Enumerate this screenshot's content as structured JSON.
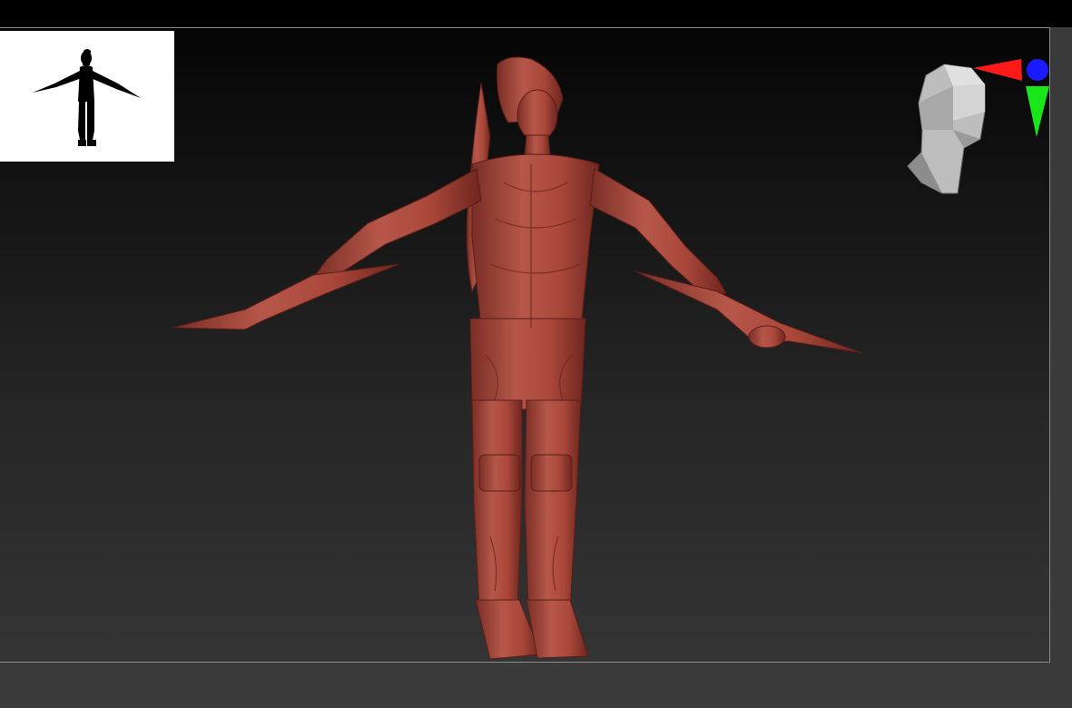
{
  "app": {
    "viewport_bg_top": "#050505",
    "viewport_bg_bottom": "#343434",
    "frame_border": "#8a8a8a"
  },
  "thumbnail": {
    "icon": "character-silhouette-icon",
    "bg": "#ffffff",
    "fg": "#000000"
  },
  "model": {
    "icon": "sculpted-character-model",
    "material_color": "#a9473a"
  },
  "orientation": {
    "head_icon": "head-gizmo-icon",
    "axes": [
      {
        "axis": "x",
        "color": "#ff1a1a",
        "icon": "x-axis-arrow-icon"
      },
      {
        "axis": "y",
        "color": "#19e619",
        "icon": "y-axis-arrow-icon"
      },
      {
        "axis": "z",
        "color": "#1a1aff",
        "icon": "z-axis-dot-icon"
      }
    ]
  }
}
